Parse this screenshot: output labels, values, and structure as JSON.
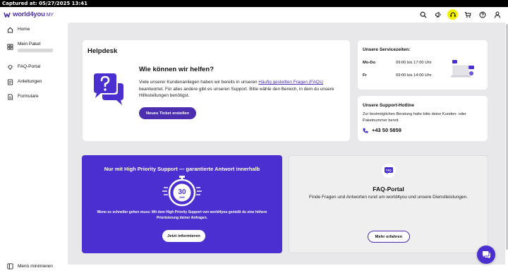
{
  "capture": {
    "text": "Captured at: 05/27/2025 13:41"
  },
  "header": {
    "brand": "world4you",
    "brand_suffix": "MY",
    "icons": [
      "search-icon",
      "megaphone-icon",
      "support-icon",
      "cart-icon",
      "help-icon",
      "account-icon"
    ]
  },
  "sidebar": {
    "items": [
      {
        "label": "Home",
        "icon": "home-icon"
      },
      {
        "label": "Mein Paket",
        "icon": "package-icon"
      },
      {
        "label": "FAQ-Portal",
        "icon": "lightbulb-icon"
      },
      {
        "label": "Anleitungen",
        "icon": "guide-icon"
      },
      {
        "label": "Formulare",
        "icon": "form-icon"
      }
    ],
    "minimize_label": "Menü minimieren"
  },
  "helpdesk": {
    "title": "Helpdesk",
    "heading": "Wie können wir helfen?",
    "text_before": "Viele unserer Kundenanliegen haben wir bereits in unseren ",
    "link": "Häufig gestellten Fragen (FAQs)",
    "text_after": " beantwortet. Für alles andere gibt es unseren Support. Bitte wähle den Bereich, in dem du unsere Hilfestellungen benötigst.",
    "button": "Neues Ticket erstellen"
  },
  "service": {
    "title": "Unsere Servicezeiten:",
    "rows": [
      {
        "day": "Mo-Do",
        "time": "09:00 bis 17:00 Uhr"
      },
      {
        "day": "Fr",
        "time": "09:00 bis 14:00 Uhr"
      }
    ]
  },
  "hotline": {
    "title": "Unsere Support-Hotline",
    "text": "Zur bestmöglichen Beratung halte bitte deine Kunden- oder Paketnummer bereit.",
    "phone": "+43 50 5859"
  },
  "priority": {
    "title": "Nur mit High Priority Support — garantierte Antwort innerhalb",
    "timer_value": "30",
    "timer_unit": "MIN",
    "description": "Wenn es schneller gehen muss: Mit dem High Priority Support von world4you genießt du eine höhere Priorisierung deiner Anfragen.",
    "button": "Jetzt informieren"
  },
  "faq": {
    "badge": "FAQ",
    "title": "FAQ-Portal",
    "text": "Finde Fragen und Antworten rund um world4you und unsere Dienstleistungen.",
    "button": "Mehr erfahren"
  },
  "colors": {
    "brand": "#4b2fb0",
    "accent": "#4b2fd0",
    "highlight": "#f0f000"
  }
}
